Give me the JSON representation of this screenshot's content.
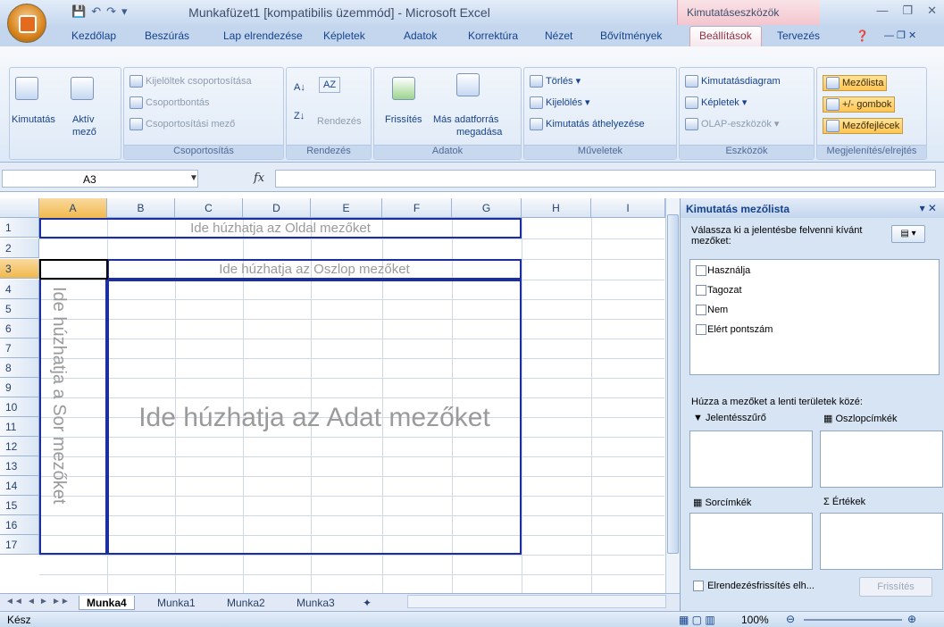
{
  "window": {
    "title": "Munkafüzet1  [kompatibilis üzemmód] - Microsoft Excel",
    "context_tab_title": "Kimutatáseszközök"
  },
  "tabs": [
    "Kezdőlap",
    "Beszúrás",
    "Lap elrendezése",
    "Képletek",
    "Adatok",
    "Korrektúra",
    "Nézet",
    "Bővítmények",
    "Beállítások",
    "Tervezés"
  ],
  "active_tab": "Beállítások",
  "ribbon": {
    "pivot": {
      "btn": "Kimutatás",
      "active_field_1": "Aktív",
      "active_field_2": "mező"
    },
    "grouping": {
      "label": "Csoportosítás",
      "sel_group": "Kijelöltek csoportosítása",
      "ungroup": "Csoportbontás",
      "group_field": "Csoportosítási mező"
    },
    "sort": {
      "label": "Rendezés",
      "sort_btn": "Rendezés"
    },
    "data": {
      "label": "Adatok",
      "refresh": "Frissítés",
      "change_source_1": "Más adatforrás",
      "change_source_2": "megadása"
    },
    "actions": {
      "label": "Műveletek",
      "clear": "Törlés",
      "select": "Kijelölés",
      "move": "Kimutatás áthelyezése"
    },
    "tools": {
      "label": "Eszközök",
      "chart": "Kimutatásdiagram",
      "formulas": "Képletek",
      "olap": "OLAP-eszközök"
    },
    "show": {
      "label": "Megjelenítés/elrejtés",
      "field_list": "Mezőlista",
      "buttons": "+/- gombok",
      "headers": "Mezőfejlécek"
    }
  },
  "formula_bar": {
    "name_box": "A3",
    "fx": "fx",
    "formula": ""
  },
  "columns": [
    "A",
    "B",
    "C",
    "D",
    "E",
    "F",
    "G",
    "H",
    "I"
  ],
  "rows": [
    "1",
    "2",
    "3",
    "4",
    "5",
    "6",
    "7",
    "8",
    "9",
    "10",
    "11",
    "12",
    "13",
    "14",
    "15",
    "16",
    "17"
  ],
  "drop_zones": {
    "page": "Ide húzhatja az Oldal mezőket",
    "column": "Ide húzhatja az Oszlop mezőket",
    "row": "Ide húzhatja a Sor mezőket",
    "data": "Ide húzhatja az Adat mezőket"
  },
  "sheets": [
    "Munka4",
    "Munka1",
    "Munka2",
    "Munka3"
  ],
  "active_sheet": "Munka4",
  "status": {
    "text": "Kész",
    "zoom": "100%"
  },
  "panel": {
    "title": "Kimutatás mezőlista",
    "instruction": "Válassza ki a jelentésbe felvenni kívánt mezőket:",
    "fields": [
      "Használja",
      "Tagozat",
      "Nem",
      "Elért pontszám"
    ],
    "drag_instruction": "Húzza a mezőket a lenti területek közé:",
    "areas": {
      "filter": "Jelentésszűrő",
      "columns": "Oszlopcímkék",
      "rows": "Sorcímkék",
      "values": "Értékek"
    },
    "defer": "Elrendezésfrissítés elh...",
    "refresh": "Frissítés"
  }
}
